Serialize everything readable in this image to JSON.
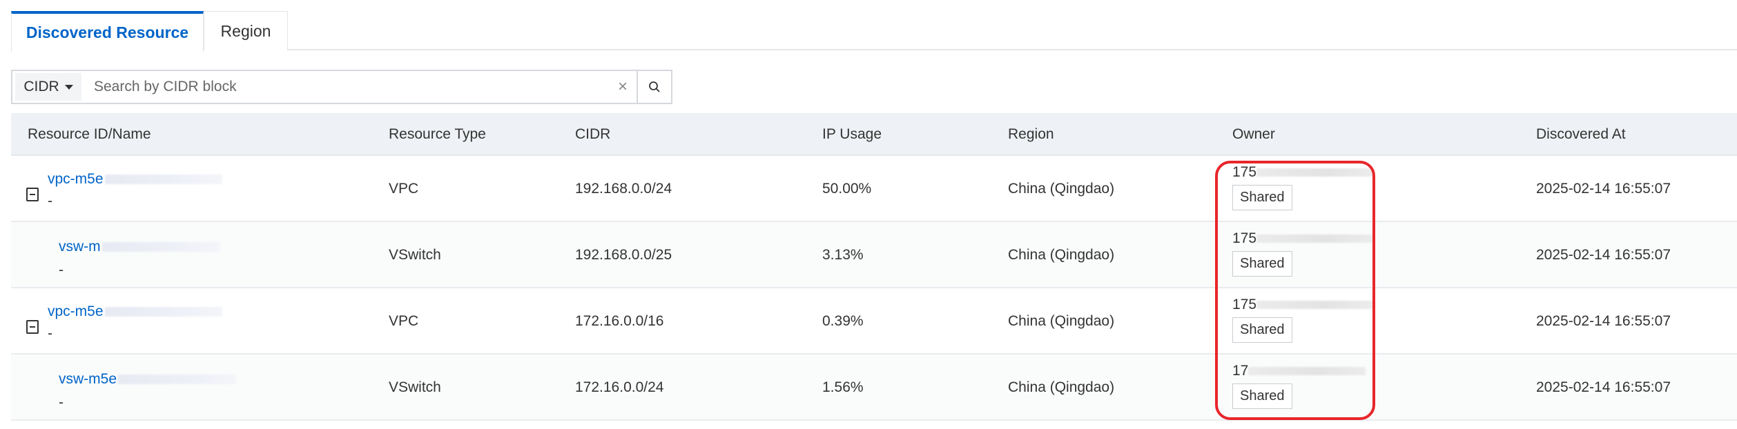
{
  "tabs": [
    {
      "label": "Discovered Resource",
      "active": true
    },
    {
      "label": "Region",
      "active": false
    }
  ],
  "search": {
    "field": "CIDR",
    "placeholder": "Search by CIDR block"
  },
  "table": {
    "columns": [
      "Resource ID/Name",
      "Resource Type",
      "CIDR",
      "IP Usage",
      "Region",
      "Owner",
      "Discovered At"
    ],
    "rows": [
      {
        "id": "vpc-m5e",
        "name": "-",
        "type": "VPC",
        "cidr": "192.168.0.0/24",
        "usage": "50.00%",
        "region": "China (Qingdao)",
        "owner": "175",
        "tag": "Shared",
        "at": "2025-02-14 16:55:07"
      },
      {
        "id": "vsw-m",
        "name": "-",
        "type": "VSwitch",
        "cidr": "192.168.0.0/25",
        "usage": "3.13%",
        "region": "China (Qingdao)",
        "owner": "175",
        "tag": "Shared",
        "at": "2025-02-14 16:55:07"
      },
      {
        "id": "vpc-m5e",
        "name": "-",
        "type": "VPC",
        "cidr": "172.16.0.0/16",
        "usage": "0.39%",
        "region": "China (Qingdao)",
        "owner": "175",
        "tag": "Shared",
        "at": "2025-02-14 16:55:07"
      },
      {
        "id": "vsw-m5e",
        "name": "-",
        "type": "VSwitch",
        "cidr": "172.16.0.0/24",
        "usage": "1.56%",
        "region": "China (Qingdao)",
        "owner": "17",
        "tag": "Shared",
        "at": "2025-02-14 16:55:07"
      }
    ]
  },
  "colors": {
    "accent": "#0064c8",
    "highlight": "#e8262b"
  }
}
